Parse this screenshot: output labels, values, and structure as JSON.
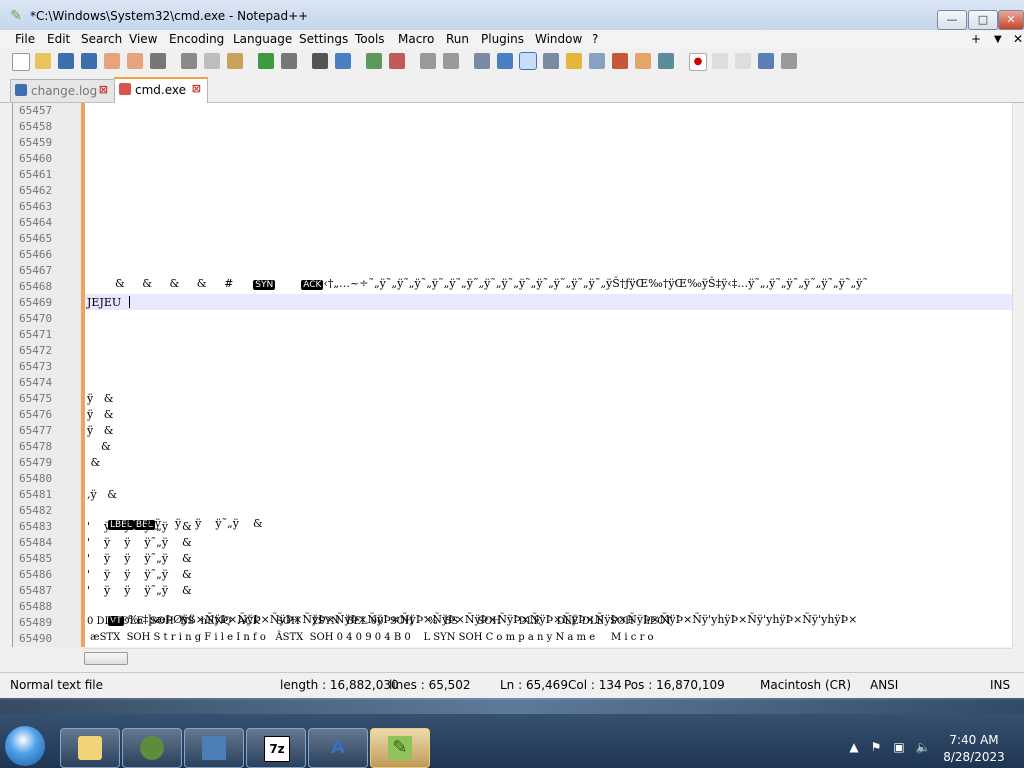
{
  "window": {
    "title": "*C:\\Windows\\System32\\cmd.exe - Notepad++",
    "minimize_label": "—",
    "maximize_label": "□",
    "close_label": "✕"
  },
  "menu": [
    "File",
    "Edit",
    "Search",
    "View",
    "Encoding",
    "Language",
    "Settings",
    "Tools",
    "Macro",
    "Run",
    "Plugins",
    "Window",
    "?"
  ],
  "menu_right": {
    "plus": "+",
    "dropdown": "▼",
    "close": "✕"
  },
  "tabs": [
    {
      "label": "change.log",
      "active": false,
      "close": "⊠"
    },
    {
      "label": "cmd.exe",
      "active": true,
      "close": "⊠"
    }
  ],
  "editor": {
    "line_numbers": [
      "65457",
      "65458",
      "65459",
      "65460",
      "65461",
      "65462",
      "65463",
      "65464",
      "65465",
      "65466",
      "65467",
      "65468",
      "65469",
      "65470",
      "65471",
      "65472",
      "65473",
      "65474",
      "65475",
      "65476",
      "65477",
      "65478",
      "65479",
      "65480",
      "65481",
      "65482",
      "65483",
      "65484",
      "65485",
      "65486",
      "65487",
      "65488",
      "65489",
      "65490"
    ],
    "lines": {
      "65467_a": "  &     &     &     &     #",
      "65467_syn": "SYN",
      "65467_ack": "ACK",
      "65467_b": "‹†„…~÷˜„ÿ˜„ÿ˜„ÿ˜„ÿ˜„ÿ˜„ÿ˜„ÿ˜„ÿ˜„ÿ˜„ÿ˜„ÿ˜„ÿ˜„ÿ˜„ÿŠ†ƒÿŒ‰†ÿŒ‰ÿŠ‡ÿ‹‡…ÿ˜„‚ÿ˜„ÿ˜„ÿ˜„ÿ˜„ÿ˜„ÿ˜",
      "65469": "JEJEU",
      "65475": "ÿ   &",
      "65476": "ÿ   &",
      "65477": "ÿ   &",
      "65478": "    &",
      "65479": " &",
      "65481": ",ÿ   &",
      "65482_a": "LBEL",
      "65482_b": "BEL",
      "65482_c": "ÿ    ÿ    ÿ    ÿ˜„ÿ    &",
      "65483": "'    ÿ    ÿ    ÿ˜„ÿ    &",
      "65484": "'    ÿ    ÿ    ÿ˜„ÿ    &",
      "65485": "'    ÿ    ÿ    ÿ˜„ÿ    &",
      "65486": "'    ÿ    ÿ    ÿ˜„ÿ    &",
      "65487": "'    ÿ    ÿ    ÿ˜„ÿ    &",
      "65488_vt": "VT",
      "65488_b": "‹‰‡þæÞØÿß×ÑÿÞ×ÑÿÞ×ÑÿÞ×ÑÿÞ×ÑÿÞ×ÑÿÞ×ÑÿÞ×ÑÿÞ×ÑÿÞ×ÑÿÞ×ÑÿÞ×ÑÿÞ×ÑÿÞ×ÑÿÞ×ÑÿÞ×Ñÿ'yhÿÞ×Ñÿ'yhÿÞ×Ñÿ'yhÿÞ×",
      "65489": "0 DLE DLE  SOH  BS  hENQ  ACK     SOH    žSYN  BEL 00  SOH   ¨%  BS      SOH    ¨DLE     DLE DLE  SOH   hEOT",
      "65490": " æSTX  SOH S t r i n g F i l e I n f o   ÂSTX  SOH 0 4 0 9 0 4 B 0    L SYN SOH C o m p a n y N a m e     M i c r o"
    }
  },
  "status": {
    "file_type": "Normal text file",
    "length": "length : 16,882,030",
    "lines": "lines : 65,502",
    "ln": "Ln : 65,469",
    "col": "Col : 134",
    "pos": "Pos : 16,870,109",
    "eol": "Macintosh (CR)",
    "encoding": "ANSI",
    "mode": "INS"
  },
  "taskbar": {
    "apps": [
      "file-explorer",
      "tree-app",
      "control-panel",
      "7zip",
      "app-a",
      "notepad-plus-plus"
    ],
    "time": "7:40 AM",
    "date": "8/28/2023"
  },
  "colors": {
    "accent_orange": "#f6a05a",
    "current_line": "#e8e8ff",
    "selected_tab_top": "#f2a243"
  }
}
